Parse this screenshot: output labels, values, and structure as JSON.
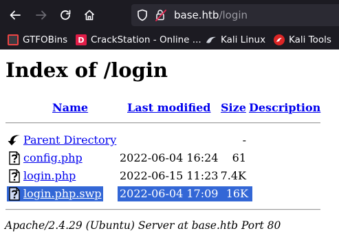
{
  "browser": {
    "url_host": "base.htb",
    "url_path": "/login",
    "bookmarks": [
      {
        "label": "GTFOBins",
        "icon": "gtfobins-icon",
        "color": "#ef4444"
      },
      {
        "label": "CrackStation - Online ...",
        "icon": "crackstation-icon",
        "color": "#e11d48"
      },
      {
        "label": "Kali Linux",
        "icon": "kali-linux-icon"
      },
      {
        "label": "Kali Tools",
        "icon": "kali-tools-icon",
        "color": "#dc2626"
      }
    ]
  },
  "page": {
    "title": "Index of /login",
    "columns": {
      "name": "Name",
      "last_modified": "Last modified",
      "size": "Size",
      "description": "Description"
    },
    "rows": [
      {
        "name": "Parent Directory",
        "date": "",
        "size": "-",
        "icon": "back-arrow-icon",
        "selected": false
      },
      {
        "name": "config.php",
        "date": "2022-06-04 16:24",
        "size": "61",
        "icon": "file-unknown-icon",
        "selected": false
      },
      {
        "name": "login.php",
        "date": "2022-06-15 11:23",
        "size": "7.4K",
        "icon": "file-unknown-icon",
        "selected": false
      },
      {
        "name": "login.php.swp",
        "date": "2022-06-04 17:09",
        "size": "16K",
        "icon": "file-unknown-icon",
        "selected": true
      }
    ],
    "footer": "Apache/2.4.29 (Ubuntu) Server at base.htb Port 80",
    "colors": {
      "link": "#0000ee",
      "selection": "#3367d6",
      "chrome": "#1c1b22"
    }
  }
}
